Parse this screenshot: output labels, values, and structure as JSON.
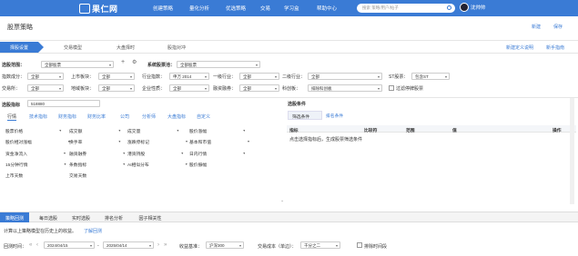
{
  "header": {
    "logo": "果仁网",
    "nav": [
      "创建策略",
      "量化分析",
      "优选策略",
      "交易",
      "学习盒",
      "帮助中心"
    ],
    "search_placeholder": "搜索 策略/用户/帖子",
    "user": "沈帅帅"
  },
  "page": {
    "title": "股票策略",
    "new_label": "新建",
    "save_label": "保存",
    "custom_label": "新建定义说明",
    "help_label": "新手指南"
  },
  "steps": [
    "择股设置",
    "交易模型",
    "大盘择时",
    "股指对冲"
  ],
  "filters": {
    "pool_label": "选股范围：",
    "pool_value": "全部股票",
    "sys_label": "系统股票池：",
    "sys_value": "全部股票",
    "row1": [
      {
        "label": "指数成分：",
        "value": "全部"
      },
      {
        "label": "上市板块：",
        "value": "全部"
      },
      {
        "label": "行业指数：",
        "value": "申万 2014"
      },
      {
        "label": "一级行业：",
        "value": "全部"
      },
      {
        "label": "二级行业：",
        "value": "全部"
      },
      {
        "label": "ST股票：",
        "value": "包含ST"
      }
    ],
    "row2": [
      {
        "label": "交易所：",
        "value": "全部"
      },
      {
        "label": "地域板块：",
        "value": "全部"
      },
      {
        "label": "企业性质：",
        "value": "全部"
      },
      {
        "label": "融资融券：",
        "value": "全部"
      },
      {
        "label": "科创板：",
        "value": "排除科创板"
      }
    ],
    "exclude_label": "过滤停牌股票",
    "stock_count_label": "选股指标",
    "stock_count_value": "518880"
  },
  "factor_tabs": [
    "行情",
    "技术指标",
    "财务指标",
    "财务比率",
    "公司",
    "分析师",
    "大盘指标",
    "自定义"
  ],
  "factors": [
    [
      "股票价格",
      "成交额",
      "成交量",
      "股价涨幅"
    ],
    [
      "股价相对涨幅",
      "换手率",
      "涨跌停标记",
      "基本和市值"
    ],
    [
      "资金净流入",
      "融资融券",
      "港资持股",
      "日内行情"
    ],
    [
      "15分钟行情",
      "条数指标",
      "AI相似分布",
      "股价振幅"
    ],
    [
      "上市天数",
      "交易天数",
      "",
      ""
    ]
  ],
  "right_panel": {
    "title": "选股条件",
    "tabs": [
      "筛选条件",
      "排名条件"
    ],
    "headers": [
      "指标",
      "比较符",
      "范围",
      "值",
      "操作"
    ],
    "hint": "点击选择指标后，生成股票筛选条件"
  },
  "bottom": {
    "tabs": [
      "策略回测",
      "每日选股",
      "实时选股",
      "排名分析",
      "因子相关性"
    ],
    "desc": "计算以上策略模型在历史上的收益。",
    "desc_link": "了解回测",
    "period_label": "回测时间：",
    "start": "2024/04/15",
    "end": "2025/04/14",
    "bench_label": "收益基准：",
    "bench_value": "沪深300",
    "cost_label": "交易成本（单边）：",
    "cost_value": "千分之二",
    "exclude_label": "排除时间段"
  }
}
